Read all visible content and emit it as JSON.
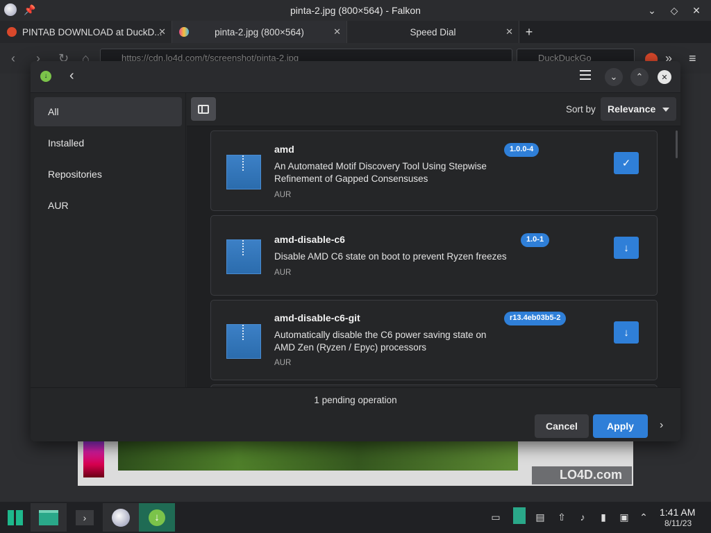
{
  "window": {
    "title": "pinta-2.jpg (800×564) - Falkon"
  },
  "tabs": [
    {
      "label": "PINTAB DOWNLOAD at DuckD..."
    },
    {
      "label": "pinta-2.jpg (800×564)"
    },
    {
      "label": "Speed Dial"
    }
  ],
  "navbar": {
    "url": "https://cdn.lo4d.com/t/screenshot/pinta-2.jpg",
    "search_placeholder": "DuckDuckGo"
  },
  "dialog": {
    "sidebar": {
      "items": [
        {
          "label": "All",
          "active": true
        },
        {
          "label": "Installed",
          "active": false
        },
        {
          "label": "Repositories",
          "active": false
        },
        {
          "label": "AUR",
          "active": false
        }
      ]
    },
    "sort": {
      "label": "Sort by",
      "value": "Relevance"
    },
    "packages": [
      {
        "name": "amd",
        "version": "1.0.0-4",
        "description": "An Automated Motif Discovery Tool Using Stepwise Refinement of Gapped Consensuses",
        "repo": "AUR",
        "action": "check-icon"
      },
      {
        "name": "amd-disable-c6",
        "version": "1.0-1",
        "description": "Disable AMD C6 state on boot to prevent Ryzen freezes",
        "repo": "AUR",
        "action": "download-icon"
      },
      {
        "name": "amd-disable-c6-git",
        "version": "r13.4eb03b5-2",
        "description": "Automatically disable the C6 power saving state on AMD Zen (Ryzen / Epyc) processors",
        "repo": "AUR",
        "action": "download-icon"
      }
    ],
    "footer": {
      "pending": "1 pending operation",
      "cancel_label": "Cancel",
      "apply_label": "Apply"
    }
  },
  "background": {
    "watermark": "LO4D.com"
  },
  "taskbar": {
    "time": "1:41 AM",
    "date": "8/11/23"
  },
  "colors": {
    "accent": "#2f7fd8",
    "dialog_bg": "#252628"
  }
}
